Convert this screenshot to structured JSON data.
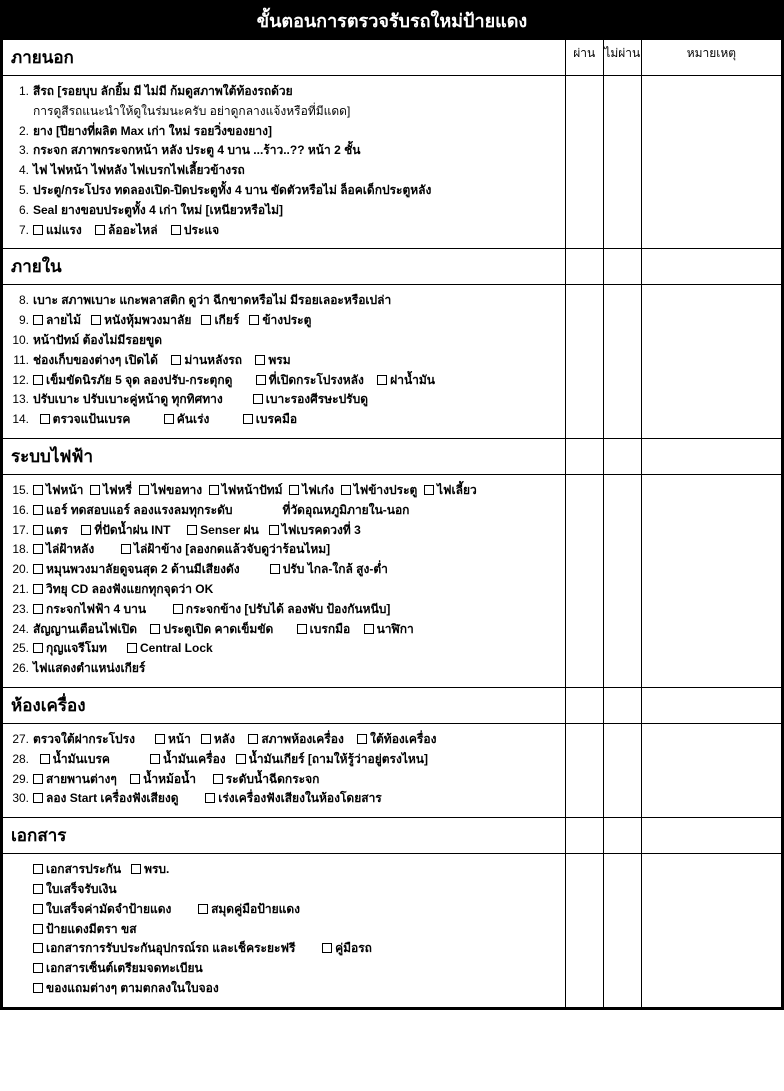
{
  "title": "ขั้นตอนการตรวจรับรถใหม่ป้ายแดง",
  "cols": {
    "pass": "ผ่าน",
    "fail": "ไม่ผ่าน",
    "note": "หมายเหตุ"
  },
  "s1": {
    "head": "ภายนอก",
    "n1": "1.",
    "t1a": "สีรถ [รอยบุบ ลักยิ้ม มี ไม่มี ก้มดูสภาพใต้ท้องรถด้วย",
    "t1b": "การดูสีรถแนะนำให้ดูในร่มนะครับ อย่าดูกลางแจ้งหรือที่มีแดด]",
    "n2": "2.",
    "t2": "ยาง [ปียางที่ผลิต Max เก่า ใหม่ รอยวิ่งของยาง]",
    "n3": "3.",
    "t3": "กระจก สภาพกระจกหน้า หลัง ประตู 4 บาน ...ร้าว..?? หน้า 2 ชั้น",
    "n4": "4.",
    "t4": "ไฟ ไฟหน้า ไฟหลัง ไฟเบรกไฟเลี้ยวข้างรถ",
    "n5": "5.",
    "t5": "ประตู/กระโปรง ทดลองเปิด-ปิดประตูทั้ง 4 บาน ขัดตัวหรือไม่ ล็อคเด็กประตูหลัง",
    "n6": "6.",
    "t6": "Seal ยางขอบประตูทั้ง 4 เก่า ใหม่ [เหนียวหรือไม่]",
    "n7": "7.",
    "c7a": "แม่แรง",
    "c7b": "ล้ออะไหล่",
    "c7c": "ประแจ"
  },
  "s2": {
    "head": "ภายใน",
    "n8": "8.",
    "t8": "เบาะ สภาพเบาะ แกะพลาสติก ดูว่า ฉีกขาดหรือไม่ มีรอยเลอะหรือเปล่า",
    "n9": "9.",
    "c9a": "ลายไม้",
    "c9b": "หนังหุ้มพวงมาลัย",
    "c9c": "เกียร์",
    "c9d": "ข้างประตู",
    "n10": "10.",
    "t10": "หน้าปัทม์ ต้องไม่มีรอยขูด",
    "n11": "11.",
    "t11": "ช่องเก็บของต่างๆ เปิดได้",
    "c11a": "ม่านหลังรถ",
    "c11b": "พรม",
    "n12": "12.",
    "c12a": "เข็มขัดนิรภัย 5 จุด ลองปรับ-กระตุกดู",
    "c12b": "ที่เปิดกระโปรงหลัง",
    "c12c": "ฝาน้ำมัน",
    "n13": "13.",
    "t13": "ปรับเบาะ ปรับเบาะคู่หน้าดู ทุกทิศทาง",
    "c13a": "เบาะรองศีรษะปรับดู",
    "n14": "14.",
    "c14a": "ตรวจแป้นเบรค",
    "c14b": "คันเร่ง",
    "c14c": "เบรคมือ"
  },
  "s3": {
    "head": "ระบบไฟฟ้า",
    "n15": "15.",
    "c15a": "ไฟหน้า",
    "c15b": "ไฟหรี่",
    "c15c": "ไฟขอทาง",
    "c15d": "ไฟหน้าปัทม์",
    "c15e": "ไฟเก๋ง",
    "c15f": "ไฟข้างประตู",
    "c15g": "ไฟเลี้ยว",
    "n16": "16.",
    "c16a": "แอร์ ทดสอบแอร์ ลองแรงลมทุกระดับ",
    "t16": "ที่วัดอุณหภูมิภายใน-นอก",
    "n17": "17.",
    "c17a": "แตร",
    "c17b": "ที่ปัดน้ำฝน INT",
    "c17c": "Senser ฝน",
    "c17d": "ไฟเบรคดวงที่ 3",
    "n18": "18.",
    "c18a": "ไล่ฝ้าหลัง",
    "c18b": "ไล่ฝ้าข้าง [ลองกดแล้วจับดูว่าร้อนไหม]",
    "n20": "20.",
    "c20a": "หมุนพวงมาลัยดูจนสุด 2 ด้านมีเสียงดัง",
    "c20b": "ปรับ ไกล-ใกล้ สูง-ต่ำ",
    "n21": "21.",
    "c21a": "วิทยุ CD ลองฟังแยกทุกจุดว่า OK",
    "n23": "23.",
    "c23a": "กระจกไฟฟ้า 4 บาน",
    "c23b": "กระจกข้าง [ปรับได้ ลองพับ ป้องกันหนีบ]",
    "n24": "24.",
    "t24": "สัญญานเตือนไฟเปิด",
    "c24a": "ประตูเปิด คาดเข็มขัด",
    "c24b": "เบรกมือ",
    "c24c": "นาฬิกา",
    "n25": "25.",
    "c25a": "กุญแจรีโมท",
    "c25b": "Central Lock",
    "n26": "26.",
    "t26": "ไฟแสดงตำแหน่งเกียร์"
  },
  "s4": {
    "head": "ห้องเครื่อง",
    "n27": "27.",
    "t27": "ตรวจใต้ฝากระโปรง",
    "c27a": "หน้า",
    "c27b": "หลัง",
    "c27c": "สภาพห้องเครื่อง",
    "c27d": "ใต้ท้องเครื่อง",
    "n28": "28.",
    "c28a": "น้ำมันเบรค",
    "c28b": "น้ำมันเครื่อง",
    "c28c": "น้ำมันเกียร์ [ถามให้รู้ว่าอยู่ตรงไหน]",
    "n29": "29.",
    "c29a": "สายพานต่างๆ",
    "c29b": "น้ำหม้อน้ำ",
    "c29c": "ระดับน้ำฉีดกระจก",
    "n30": "30.",
    "c30a": "ลอง Start เครื่องฟังเสียงดู",
    "c30b": "เร่งเครื่องฟังเสียงในห้องโดยสาร"
  },
  "s5": {
    "head": "เอกสาร",
    "d1": "เอกสารประกัน",
    "d1b": "พรบ.",
    "d2": "ใบเสร็จรับเงิน",
    "d3": "ใบเสร็จค่ามัดจำป้ายแดง",
    "d3b": "สมุดคู่มือป้ายแดง",
    "d4": "ป้ายแดงมีตรา ขส",
    "d5": "เอกสารการรับประกันอุปกรณ์รถ และเช็คระยะฟรี",
    "d5b": "คู่มือรถ",
    "d6": "เอกสารเซ็นต์เตรียมจดทะเบียน",
    "d7": "ของแถมต่างๆ ตามตกลงในใบจอง"
  }
}
